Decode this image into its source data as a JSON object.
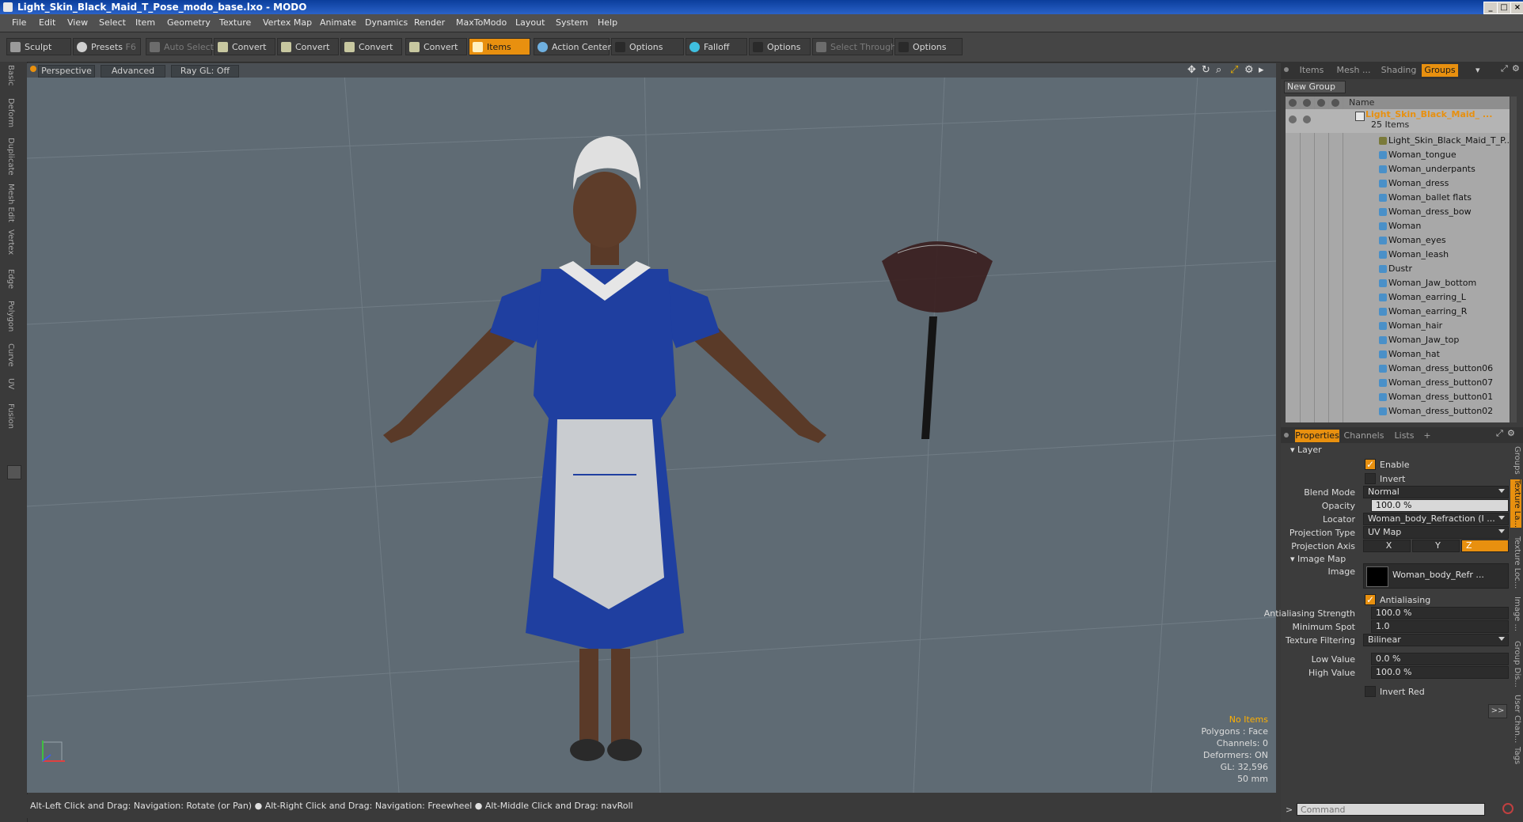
{
  "window": {
    "title": "Light_Skin_Black_Maid_T_Pose_modo_base.lxo - MODO"
  },
  "menu": [
    "File",
    "Edit",
    "View",
    "Select",
    "Item",
    "Geometry",
    "Texture",
    "Vertex Map",
    "Animate",
    "Dynamics",
    "Render",
    "MaxToModo",
    "Layout",
    "System",
    "Help"
  ],
  "toolbar": {
    "sculpt": "Sculpt",
    "presets": "Presets",
    "presets_key": "F6",
    "auto_select": "Auto Select",
    "convert1": "Convert",
    "convert2": "Convert",
    "convert3": "Convert",
    "convert4": "Convert",
    "items": "Items",
    "action_center": "Action Center",
    "options1": "Options",
    "falloff": "Falloff",
    "options2": "Options",
    "select_through": "Select Through",
    "options3": "Options"
  },
  "left_tabs": [
    "Basic",
    "Deform",
    "Duplicate",
    "Mesh Edit",
    "Vertex",
    "Edge",
    "Polygon",
    "Curve",
    "UV",
    "Fusion"
  ],
  "viewport": {
    "perspective": "Perspective",
    "advanced": "Advanced",
    "raygl": "Ray GL: Off",
    "info": {
      "items": "No Items",
      "polygons": "Polygons : Face",
      "channels": "Channels: 0",
      "deformers": "Deformers: ON",
      "gl": "GL: 32,596",
      "focal": "50 mm"
    }
  },
  "statusbar": {
    "text": "Alt-Left Click and Drag: Navigation: Rotate (or Pan) ● Alt-Right Click and Drag: Navigation: Freewheel ● Alt-Middle Click and Drag: navRoll"
  },
  "panel": {
    "tabs": {
      "items": "Items",
      "mesh": "Mesh ...",
      "shading": "Shading",
      "groups": "Groups"
    },
    "new_group": "New Group",
    "name_header": "Name",
    "group_name": "Light_Skin_Black_Maid_ ...",
    "group_count": "25 Items",
    "items": [
      "Light_Skin_Black_Maid_T_P...",
      "Woman_tongue",
      "Woman_underpants",
      "Woman_dress",
      "Woman_ballet flats",
      "Woman_dress_bow",
      "Woman",
      "Woman_eyes",
      "Woman_leash",
      "Dustr",
      "Woman_Jaw_bottom",
      "Woman_earring_L",
      "Woman_earring_R",
      "Woman_hair",
      "Woman_Jaw_top",
      "Woman_hat",
      "Woman_dress_button06",
      "Woman_dress_button07",
      "Woman_dress_button01",
      "Woman_dress_button02"
    ]
  },
  "props": {
    "tabs": {
      "properties": "Properties",
      "channels": "Channels",
      "lists": "Lists",
      "plus": "+"
    },
    "layer": "Layer",
    "enable": "Enable",
    "invert": "Invert",
    "blend_mode_label": "Blend Mode",
    "blend_mode": "Normal",
    "opacity_label": "Opacity",
    "opacity": "100.0 %",
    "locator_label": "Locator",
    "locator": "Woman_body_Refraction (I ...",
    "projection_type_label": "Projection Type",
    "projection_type": "UV Map",
    "projection_axis_label": "Projection Axis",
    "axis_x": "X",
    "axis_y": "Y",
    "axis_z": "Z",
    "image_map": "Image Map",
    "image_label": "Image",
    "image": "Woman_body_Refr ...",
    "antialiasing": "Antialiasing",
    "aa_strength_label": "Antialiasing Strength",
    "aa_strength": "100.0 %",
    "min_spot_label": "Minimum Spot",
    "min_spot": "1.0",
    "tex_filter_label": "Texture Filtering",
    "tex_filter": "Bilinear",
    "low_label": "Low Value",
    "low": "0.0 %",
    "high_label": "High Value",
    "high": "100.0 %",
    "invert_red": "Invert Red",
    "more": ">>",
    "command_placeholder": "Command"
  },
  "side_tabs": [
    "Groups",
    "Texture La...",
    "Texture Loc...",
    "Image ...",
    "Group Dis...",
    "User Chan...",
    "Tags"
  ],
  "colors": {
    "accent": "#e8900f",
    "viewport": "#5f6b74",
    "dress": "#1f3fa0"
  }
}
